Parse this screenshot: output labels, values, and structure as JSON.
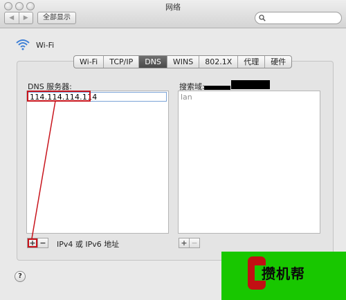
{
  "window": {
    "title": "网络"
  },
  "toolbar": {
    "show_all_label": "全部显示",
    "back_glyph": "◀",
    "forward_glyph": "▶",
    "search_placeholder": ""
  },
  "header": {
    "interface_name": "Wi-Fi"
  },
  "tabs": [
    {
      "label": "Wi-Fi",
      "active": false
    },
    {
      "label": "TCP/IP",
      "active": false
    },
    {
      "label": "DNS",
      "active": true
    },
    {
      "label": "WINS",
      "active": false
    },
    {
      "label": "802.1X",
      "active": false
    },
    {
      "label": "代理",
      "active": false
    },
    {
      "label": "硬件",
      "active": false
    }
  ],
  "dns": {
    "label": "DNS 服务器:",
    "servers": [
      "114.114.114.114"
    ],
    "add_label": "+",
    "remove_label": "−",
    "address_hint": "IPv4 或 IPv6 地址"
  },
  "search_domains": {
    "label": "搜索域:",
    "domains": [
      "lan"
    ],
    "add_label": "+",
    "remove_label": "−"
  },
  "help": {
    "label": "?"
  },
  "watermark": {
    "text": "攒机帮"
  },
  "colors": {
    "highlight": "#c8141c",
    "watermark_bg": "#18c700",
    "active_tab": "#4a4a4a"
  }
}
